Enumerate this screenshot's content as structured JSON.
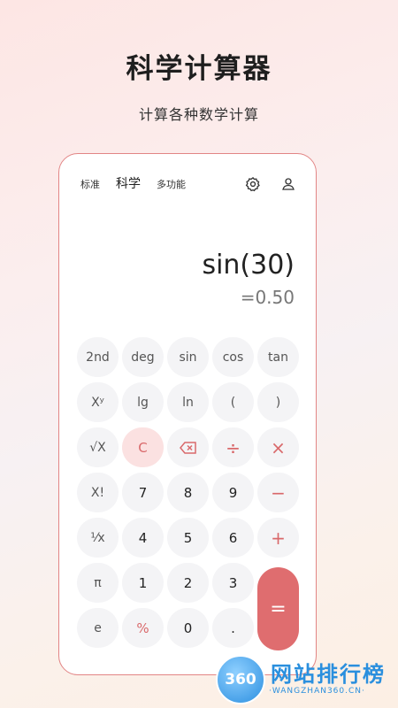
{
  "hero": {
    "title": "科学计算器",
    "subtitle": "计算各种数学计算"
  },
  "tabs": {
    "standard": "标准",
    "scientific": "科学",
    "multifunction": "多功能"
  },
  "icons": {
    "settings": "gear-icon",
    "profile": "person-icon"
  },
  "display": {
    "expression": "sin(30)",
    "result": "=0.50"
  },
  "keys": {
    "r1": [
      "2nd",
      "deg",
      "sin",
      "cos",
      "tan"
    ],
    "r2": [
      "Xʸ",
      "lg",
      "ln",
      "(",
      ")"
    ],
    "r3": [
      "√X",
      "C",
      "",
      "÷",
      "×"
    ],
    "r4": [
      "X!",
      "7",
      "8",
      "9",
      "−"
    ],
    "r5": [
      "¹⁄x",
      "4",
      "5",
      "6",
      "+"
    ],
    "r6": [
      "π",
      "1",
      "2",
      "3"
    ],
    "r7": [
      "e",
      "%",
      "0",
      "."
    ],
    "equals": "="
  },
  "colors": {
    "accent": "#df6d6f",
    "key_bg": "#f4f4f6",
    "border": "#e28585"
  },
  "watermark": {
    "badge": "360",
    "name": "网站排行榜",
    "domain": "·WANGZHAN360.CN·"
  }
}
